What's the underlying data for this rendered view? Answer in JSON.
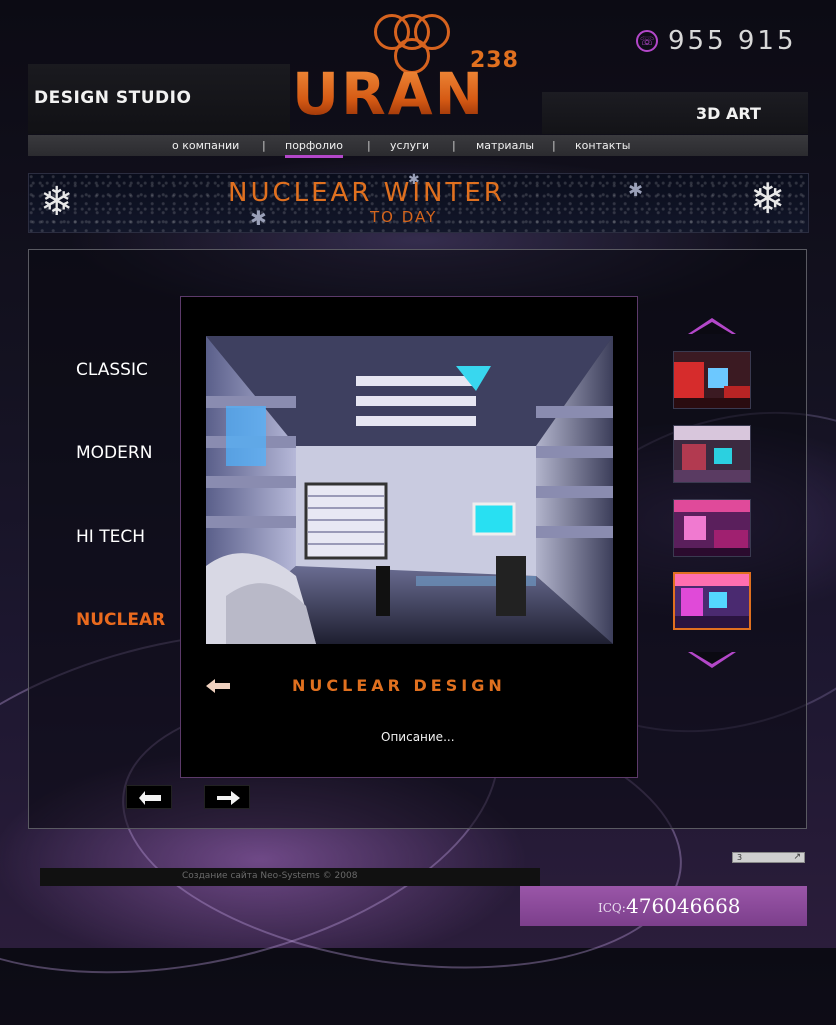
{
  "header": {
    "logo_text": "URAN",
    "logo_superscript": "238",
    "left_tagline": "DESIGN STUDIO",
    "right_tagline": "3D ART",
    "phone": "955 915"
  },
  "nav": {
    "items": [
      {
        "label": "о компании"
      },
      {
        "label": "порфолио"
      },
      {
        "label": "услуги"
      },
      {
        "label": "матриалы"
      },
      {
        "label": "контакты"
      }
    ],
    "separator": "|",
    "active_index": 1
  },
  "banner": {
    "title": "NUCLEAR WINTER",
    "subtitle": "TO DAY"
  },
  "portfolio": {
    "categories": [
      {
        "label": "CLASSIC"
      },
      {
        "label": "MODERN"
      },
      {
        "label": "HI TECH"
      },
      {
        "label": "NUCLEAR"
      }
    ],
    "active_category": 3,
    "caption": "NUCLEAR  DESIGN",
    "description": "Описание...",
    "thumbnails": 4,
    "active_thumbnail": 3
  },
  "footer": {
    "credits": "Создание сайта Neo-Systems © 2008",
    "counter": "3",
    "icq_label": "ICQ:",
    "icq_number": "476046668"
  },
  "colors": {
    "accent_orange": "#e0701f",
    "accent_purple": "#b347c9",
    "icq_bar": "#8b4a9b"
  }
}
